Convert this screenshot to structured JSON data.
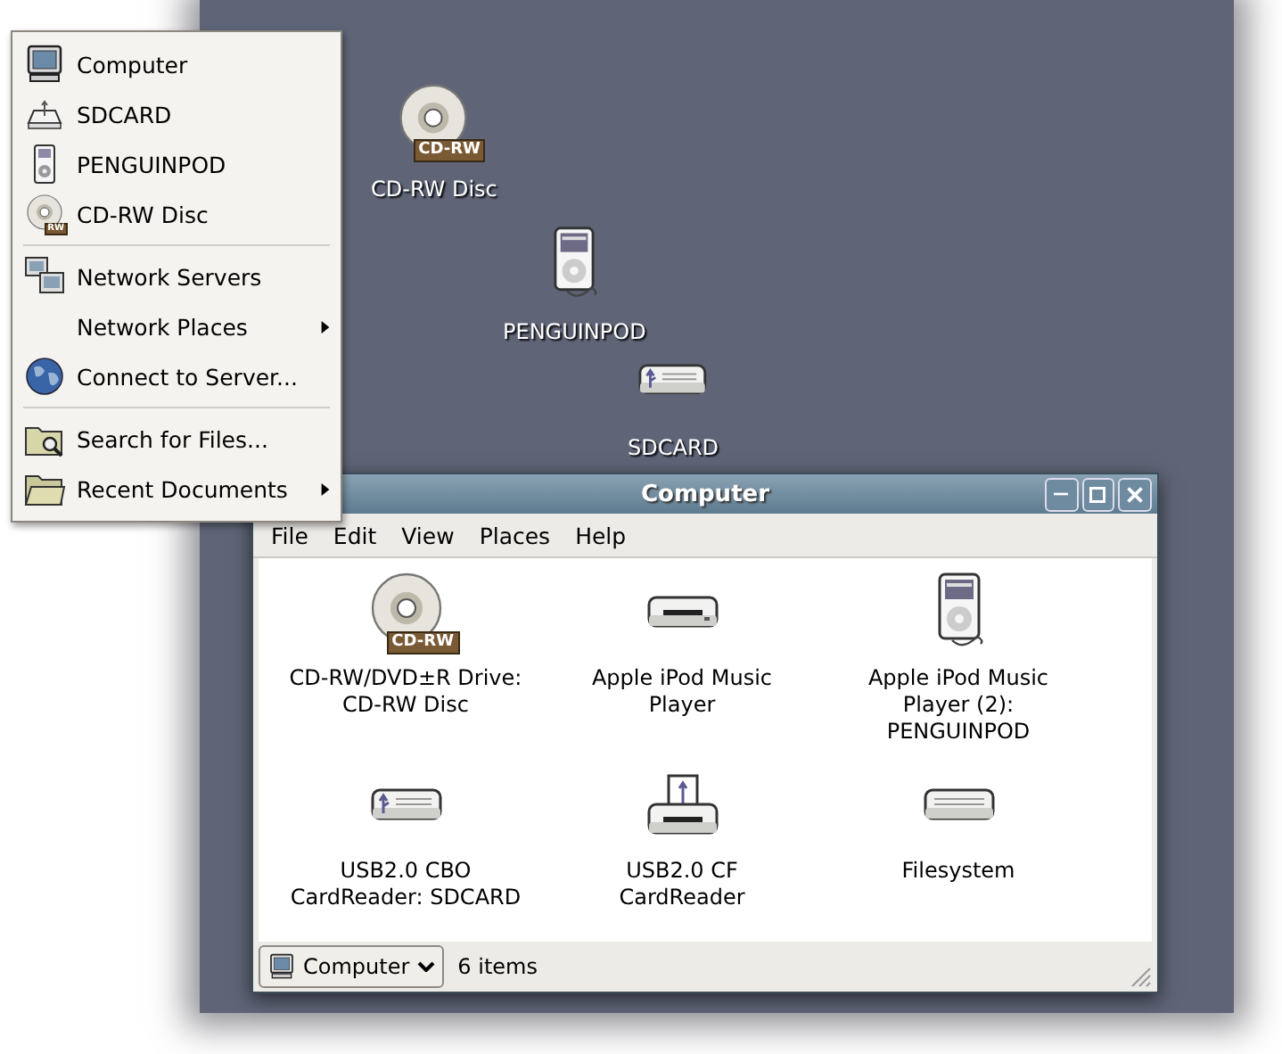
{
  "desktop_icons": [
    {
      "label": "CD-RW Disc",
      "kind": "disc",
      "badge": "CD-RW"
    },
    {
      "label": "PENGUINPOD",
      "kind": "player"
    },
    {
      "label": "SDCARD",
      "kind": "usb-drive"
    }
  ],
  "places_menu": {
    "sections": [
      [
        {
          "label": "Computer",
          "kind": "computer",
          "submenu": false
        },
        {
          "label": "SDCARD",
          "kind": "sd-drive",
          "submenu": false
        },
        {
          "label": "PENGUINPOD",
          "kind": "player-small",
          "submenu": false
        },
        {
          "label": "CD-RW Disc",
          "kind": "disc",
          "badge": "RW",
          "submenu": false
        }
      ],
      [
        {
          "label": "Network Servers",
          "kind": "network",
          "submenu": false
        },
        {
          "label": "Network Places",
          "kind": "none",
          "submenu": true
        },
        {
          "label": "Connect to Server...",
          "kind": "globe",
          "submenu": false
        }
      ],
      [
        {
          "label": "Search for Files...",
          "kind": "search-folder",
          "submenu": false
        },
        {
          "label": "Recent Documents",
          "kind": "folder",
          "submenu": true
        }
      ]
    ]
  },
  "window": {
    "title": "Computer",
    "menus": [
      "File",
      "Edit",
      "View",
      "Places",
      "Help"
    ],
    "items": [
      {
        "lines": [
          "CD-RW/DVD±R Drive:",
          "CD-RW Disc"
        ],
        "kind": "disc",
        "badge": "CD-RW"
      },
      {
        "lines": [
          "Apple iPod Music",
          "Player"
        ],
        "kind": "drive"
      },
      {
        "lines": [
          "Apple iPod Music",
          "Player (2):",
          "PENGUINPOD"
        ],
        "kind": "player"
      },
      {
        "lines": [
          "USB2.0 CBO",
          "CardReader: SDCARD"
        ],
        "kind": "usb-drive"
      },
      {
        "lines": [
          "USB2.0 CF",
          "CardReader"
        ],
        "kind": "card-reader"
      },
      {
        "lines": [
          "Filesystem"
        ],
        "kind": "fs-drive"
      }
    ],
    "status_bar": {
      "location": "Computer",
      "count": "6 items"
    }
  }
}
